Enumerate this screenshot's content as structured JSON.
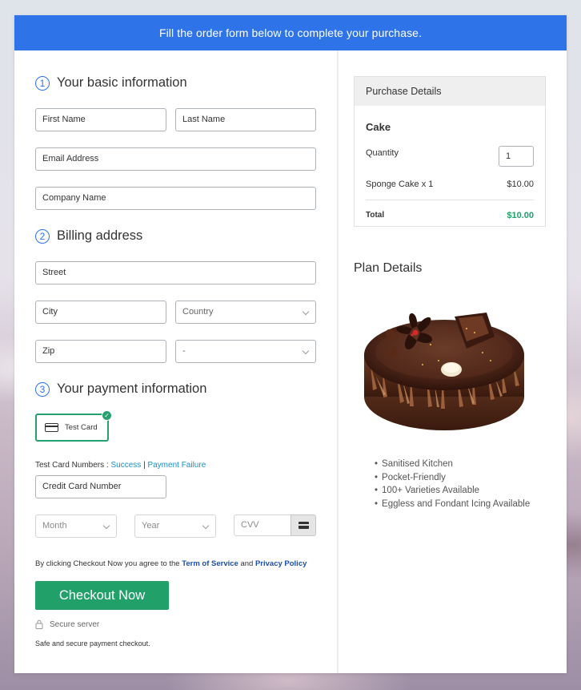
{
  "banner": {
    "text": "Fill the order form below to complete your purchase."
  },
  "sections": {
    "basic": {
      "number": "1",
      "title": "Your basic information"
    },
    "billing": {
      "number": "2",
      "title": "Billing address"
    },
    "payment": {
      "number": "3",
      "title": "Your payment information"
    }
  },
  "fields": {
    "first_name": "First Name",
    "last_name": "Last Name",
    "email": "Email Address",
    "company": "Company Name",
    "street": "Street",
    "city": "City",
    "country": "Country",
    "zip": "Zip",
    "state": "-",
    "card_number": "Credit Card Number",
    "month": "Month",
    "year": "Year",
    "cvv": "CVV"
  },
  "payment": {
    "test_card_label": "Test Card",
    "test_numbers_label": "Test Card Numbers :",
    "success_link": "Success",
    "separator": "|",
    "failure_link": "Payment Failure"
  },
  "agreement": {
    "prefix": "By clicking Checkout Now you agree to the",
    "terms_link": "Term of Service",
    "and": "and",
    "privacy_link": "Privacy Policy"
  },
  "checkout_button": "Checkout Now",
  "secure": {
    "label": "Secure server",
    "note": "Safe and secure payment checkout."
  },
  "purchase_details": {
    "header": "Purchase Details",
    "product": "Cake",
    "quantity_label": "Quantity",
    "quantity_value": "1",
    "line_item": "Sponge Cake x 1",
    "line_price": "$10.00",
    "total_label": "Total",
    "total_value": "$10.00"
  },
  "plan": {
    "title": "Plan Details",
    "features": [
      "Sanitised Kitchen",
      "Pocket-Friendly",
      "100+ Varieties Available",
      "Eggless and Fondant Icing Available"
    ]
  },
  "colors": {
    "banner": "#2e73e8",
    "accent_green": "#22a06a",
    "link": "#1a8fc4"
  }
}
